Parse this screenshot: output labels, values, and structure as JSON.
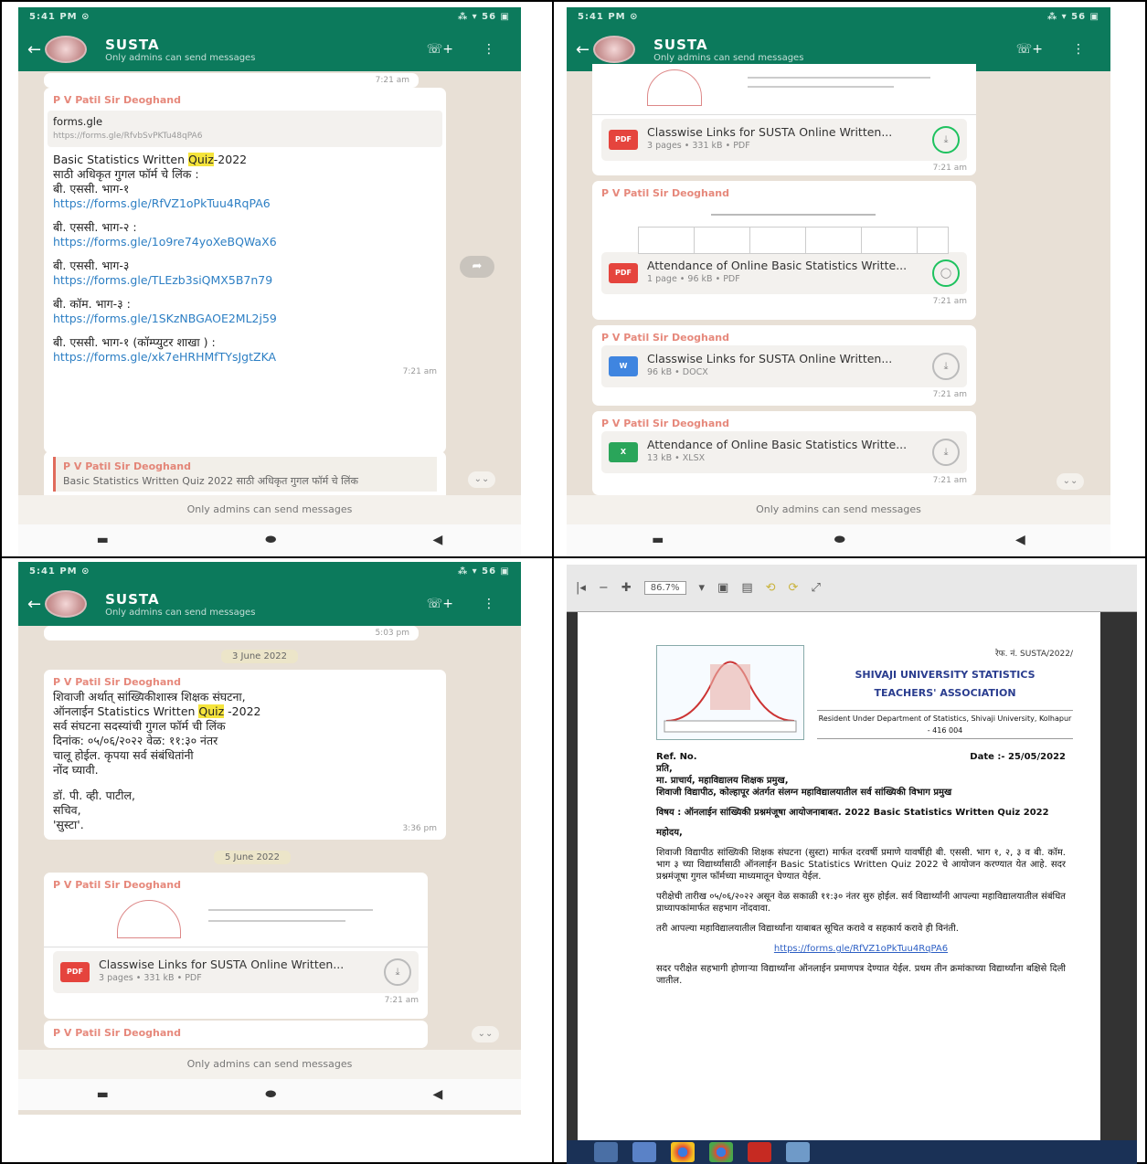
{
  "phones": [
    {
      "status_left": "5:41 PM ⊙",
      "status_right": "⁂ ▾ 56 ▣",
      "title": "SUSTA",
      "subtitle": "Only admins can send messages"
    },
    {
      "status_left": "5:41 PM ⊙",
      "status_right": "⁂ ▾ 56 ▣",
      "title": "SUSTA",
      "subtitle": "Only admins can send messages"
    },
    {
      "status_left": "5:41 PM ⊙",
      "status_right": "⁂ ▾ 56 ▣",
      "title": "SUSTA",
      "subtitle": "Only admins can send messages"
    }
  ],
  "panel1": {
    "top_time": "7:21 am",
    "sender": "P V Patil Sir Deoghand",
    "link_preview_title": "forms.gle",
    "link_preview_url": "https://forms.gle/RfvbSvPKTu48qPA6",
    "msg_intro_pre": "Basic Statistics Written ",
    "msg_intro_hl": "Quiz",
    "msg_intro_post": "-2022",
    "msg_intro_line2": "साठी अधिकृत गुगल फॉर्म चे लिंक :",
    "items": [
      {
        "label": "बी. एससी. भाग-१",
        "url": "https://forms.gle/RfVZ1oPkTuu4RqPA6"
      },
      {
        "label": "बी. एससी. भाग-२ :",
        "url": "https://forms.gle/1o9re74yoXeBQWaX6"
      },
      {
        "label": "बी. एससी. भाग-३",
        "url": "https://forms.gle/TLEzb3siQMX5B7n79"
      },
      {
        "label": "बी. कॉम. भाग-३ :",
        "url": "https://forms.gle/1SKzNBGAOE2ML2j59"
      },
      {
        "label": "बी. एससी. भाग-१ (कॉम्प्युटर शाखा ) :",
        "url": "https://forms.gle/xk7eHRHMfTYsJgtZKA"
      }
    ],
    "msg_time": "7:21 am",
    "quote_sender": "P V Patil Sir Deoghand",
    "quote_text": "Basic Statistics Written Quiz 2022 साठी अधिकृत गुगल फॉर्म चे लिंक",
    "only_admins": "Only admins can send messages"
  },
  "panel2": {
    "docs": [
      {
        "sender": "",
        "name": "Classwise Links for SUSTA Online Written...",
        "meta": "3 pages • 331 kB • PDF",
        "type": "PDF",
        "time": "7:21 am"
      },
      {
        "sender": "P V Patil Sir Deoghand",
        "name": "Attendance of Online Basic Statistics Writte...",
        "meta": "1 page • 96 kB • PDF",
        "type": "PDF",
        "time": "7:21 am"
      },
      {
        "sender": "P V Patil Sir Deoghand",
        "name": "Classwise Links for SUSTA Online Written...",
        "meta": "96 kB • DOCX",
        "type": "W",
        "time": "7:21 am"
      },
      {
        "sender": "P V Patil Sir Deoghand",
        "name": "Attendance of Online Basic Statistics Writte...",
        "meta": "13 kB • XLSX",
        "type": "X",
        "time": "7:21 am"
      }
    ],
    "only_admins": "Only admins can send messages"
  },
  "panel3": {
    "top_time": "5:03 pm",
    "date1": "3 June 2022",
    "sender": "P V Patil Sir Deoghand",
    "msg_line1": "शिवाजी अर्थात् सांख्यिकीशास्त्र शिक्षक संघटना,",
    "msg_line2_pre": "ऑनलाईन Statistics Written ",
    "msg_line2_hl": "Quiz",
    "msg_line2_post": " -2022",
    "msg_line3": "सर्व संघटना सदस्यांची गुगल फॉर्म ची लिंक",
    "msg_line4": "दिनांक: ०५/०६/२०२२ वेळ: ११:३० नंतर",
    "msg_line5": "चालू होईल. कृपया सर्व संबंधितांनी",
    "msg_line6": "नोंद घ्यावी.",
    "sign1": "डॉ. पी. व्ही. पाटील,",
    "sign2": "सचिव,",
    "sign3": "'सुस्टा'.",
    "msg_time": "3:36 pm",
    "date2": "5 June 2022",
    "doc_sender": "P V Patil Sir Deoghand",
    "doc_name": "Classwise Links for SUSTA Online Written...",
    "doc_meta": "3 pages • 331 kB • PDF",
    "doc_time": "7:21 am",
    "last_sender": "P V Patil Sir Deoghand",
    "only_admins": "Only admins can send messages"
  },
  "pdf": {
    "zoom": "86.7%",
    "ref_no": "रेफ. नं. SUSTA/2022/",
    "org_line1": "SHIVAJI UNIVERSITY STATISTICS",
    "org_line2": "TEACHERS' ASSOCIATION",
    "address": "Resident Under Department of Statistics, Shivaji University, Kolhapur - 416 004",
    "ref": "Ref. No.",
    "date": "Date :- 25/05/2022",
    "to": "प्रति,",
    "para_to": "मा. प्राचार्य, महाविद्यालय शिक्षक प्रमुख,",
    "para_to2": "शिवाजी विद्यापीठ, कोल्हापूर अंतर्गत संलग्न महाविद्यालयातील सर्व सांख्यिकी विभाग प्रमुख",
    "subject": "विषय : ऑनलाईन सांख्यिकी प्रश्नमंजूषा आयोजनाबाबत. 2022 Basic Statistics Written Quiz 2022",
    "sir": "महोदय,",
    "p1": "शिवाजी विद्यापीठ सांख्यिकी शिक्षक संघटना (सुस्टा) मार्फत दरवर्षी प्रमाणे यावर्षीही बी. एससी. भाग १, २, ३ व बी. कॉम. भाग ३ च्या विद्यार्थ्यांसाठी ऑनलाईन Basic Statistics Written Quiz 2022 चे आयोजन करण्यात येत आहे. सदर प्रश्नमंजूषा गुगल फॉर्मच्या माध्यमातून घेण्यात येईल.",
    "p2": "परीक्षेची तारीख ०५/०६/२०२२ असून वेळ सकाळी ११:३० नंतर सुरु होईल. सर्व विद्यार्थ्यांनी आपल्या महाविद्यालयातील संबंधित प्राध्यापकांमार्फत सहभाग नोंदवावा.",
    "p3": "तरी आपल्या महाविद्यालयातील विद्यार्थ्यांना याबाबत सूचित करावे व सहकार्य करावे ही विनंती.",
    "link": "https://forms.gle/RfVZ1oPkTuu4RqPA6",
    "p4": "सदर परीक्षेत सहभागी होणाऱ्या विद्यार्थ्यांना ऑनलाईन प्रमाणपत्र देण्यात येईल. प्रथम तीन क्रमांकाच्या विद्यार्थ्यांना बक्षिसे दिली जातील."
  }
}
